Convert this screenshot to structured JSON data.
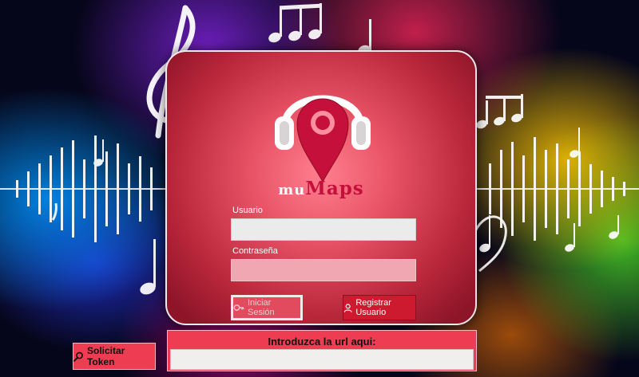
{
  "app": {
    "brand_prefix": "mu",
    "brand_suffix": "Maps"
  },
  "login": {
    "user_label": "Usuario",
    "user_value": "",
    "password_label": "Contraseña",
    "password_value": "",
    "login_button": "Iniciar Sesión",
    "register_button": "Registrar Usuario"
  },
  "token": {
    "button": "Solicitar Token"
  },
  "url": {
    "label": "Introduzca la url aqui:",
    "value": ""
  },
  "colors": {
    "accent": "#c4103a",
    "panel": "#e85366",
    "button": "#ee3d52"
  },
  "icons": {
    "logo": "headphones-pin-logo",
    "login": "key-icon",
    "register": "user-icon",
    "token": "search-icon"
  }
}
